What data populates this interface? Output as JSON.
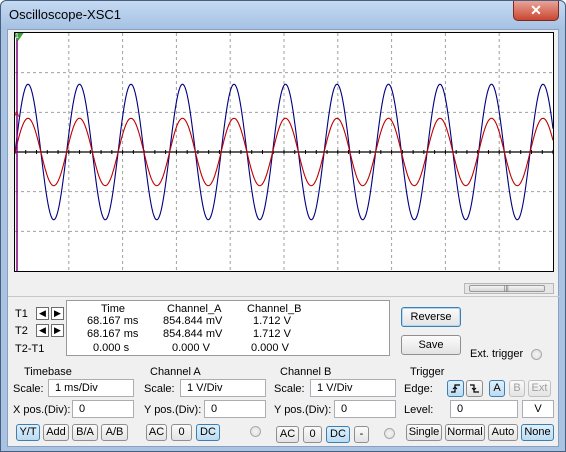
{
  "window": {
    "title": "Oscilloscope-XSC1",
    "close_glyph": "✕"
  },
  "screen": {
    "background": "#ffffff",
    "grid_color": "#a0a0a0",
    "channel_a_color": "#c00000",
    "channel_b_color": "#000080",
    "cursor_color": "#7f007f",
    "cursor_marker_1": "1",
    "cursor_marker_2": "2",
    "marker_a": "A"
  },
  "cursors": {
    "t1_label": "T1",
    "t2_label": "T2",
    "delta_label": "T2-T1",
    "left_arrow": "◀",
    "right_arrow": "▶"
  },
  "readout": {
    "headers": [
      "Time",
      "Channel_A",
      "Channel_B"
    ],
    "rows": [
      [
        "68.167 ms",
        "854.844 mV",
        "1.712 V"
      ],
      [
        "68.167 ms",
        "854.844 mV",
        "1.712 V"
      ],
      [
        "0.000 s",
        "0.000 V",
        "0.000 V"
      ]
    ]
  },
  "actions": {
    "reverse": "Reverse",
    "save": "Save",
    "ext_trigger": "Ext. trigger"
  },
  "timebase": {
    "title": "Timebase",
    "scale_label": "Scale:",
    "scale_value": "1 ms/Div",
    "xpos_label": "X pos.(Div):",
    "xpos_value": "0",
    "modes": [
      "Y/T",
      "Add",
      "B/A",
      "A/B"
    ],
    "active_mode": "Y/T"
  },
  "channel_a": {
    "title": "Channel A",
    "scale_label": "Scale:",
    "scale_value": "1  V/Div",
    "ypos_label": "Y pos.(Div):",
    "ypos_value": "0",
    "coupling": [
      "AC",
      "0",
      "DC"
    ],
    "active_coupling": "DC"
  },
  "channel_b": {
    "title": "Channel B",
    "scale_label": "Scale:",
    "scale_value": "1  V/Div",
    "ypos_label": "Y pos.(Div):",
    "ypos_value": "0",
    "coupling": [
      "AC",
      "0",
      "DC",
      "-"
    ],
    "active_coupling": "DC"
  },
  "trigger": {
    "title": "Trigger",
    "edge_label": "Edge:",
    "edge_rising_glyph": "⎍",
    "edge_falling_glyph": "⎍",
    "sources": [
      "A",
      "B",
      "Ext"
    ],
    "active_source": "A",
    "level_label": "Level:",
    "level_value": "0",
    "level_unit": "V",
    "modes": [
      "Single",
      "Normal",
      "Auto",
      "None"
    ],
    "active_mode": "None"
  }
}
